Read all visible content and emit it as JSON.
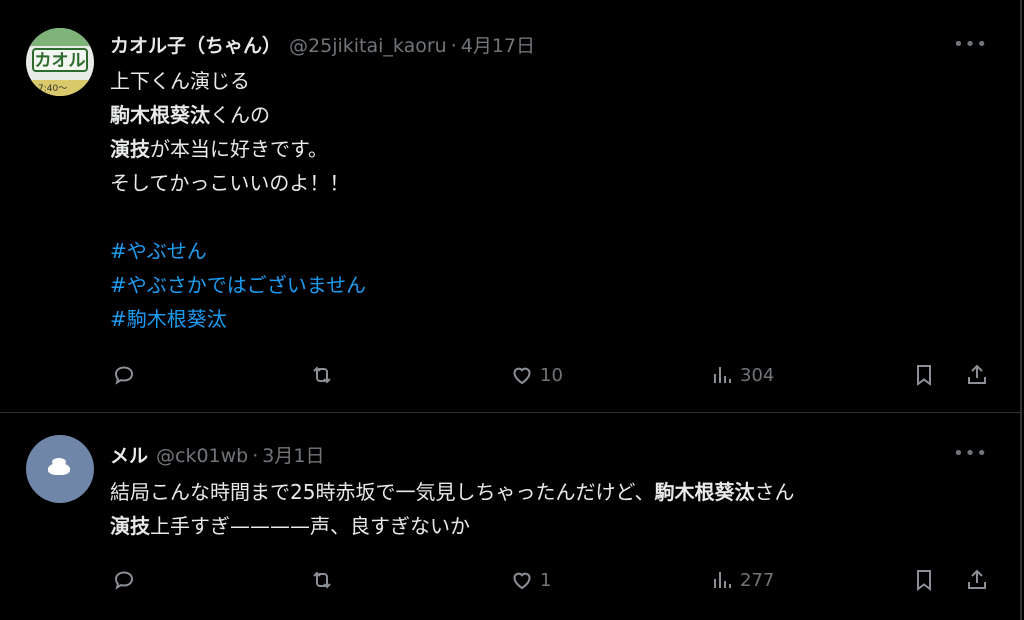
{
  "tweets": [
    {
      "name": "カオル子（ちゃん）",
      "handle": "@25jikitai_kaoru",
      "dot": "·",
      "date": "4月17日",
      "avatar_text": "カオル",
      "avatar_time": "7:40〜",
      "lines": [
        [
          {
            "t": "上下くん演じる",
            "s": "normal"
          }
        ],
        [
          {
            "t": "駒木根葵汰",
            "s": "bold"
          },
          {
            "t": "くんの",
            "s": "normal"
          }
        ],
        [
          {
            "t": "演技",
            "s": "bold"
          },
          {
            "t": "が本当に好きです。",
            "s": "normal"
          }
        ],
        [
          {
            "t": "そしてかっこいいのよ！！",
            "s": "normal"
          }
        ],
        [],
        [
          {
            "t": "#やぶせん",
            "s": "tag"
          }
        ],
        [
          {
            "t": "#やぶさかではございません",
            "s": "tag"
          }
        ],
        [
          {
            "t": "#駒木根葵汰",
            "s": "tag"
          }
        ]
      ],
      "likes": "10",
      "views": "304"
    },
    {
      "name": "メル",
      "handle": "@ck01wb",
      "dot": "·",
      "date": "3月1日",
      "lines": [
        [
          {
            "t": "結局こんな時間まで25時赤坂で一気見しちゃったんだけど、",
            "s": "normal"
          },
          {
            "t": "駒木根葵汰",
            "s": "bold"
          },
          {
            "t": "さん",
            "s": "normal"
          }
        ],
        [
          {
            "t": "演技",
            "s": "bold"
          },
          {
            "t": "上手すぎ————声、良すぎないか",
            "s": "normal"
          }
        ]
      ],
      "likes": "1",
      "views": "277"
    }
  ],
  "icons": [
    "reply-icon",
    "retweet-icon",
    "heart-icon",
    "views-icon",
    "bookmark-icon",
    "share-icon",
    "more-icon"
  ],
  "colors": {
    "background": "#000000",
    "text": "#e7e9ea",
    "muted": "#71767b",
    "hashtag": "#1d9bf0",
    "divider": "#2f3336"
  }
}
